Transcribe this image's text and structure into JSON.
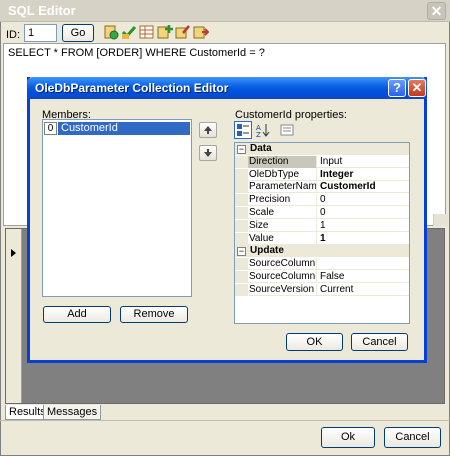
{
  "outer": {
    "title": "SQL Editor",
    "id_label": "ID:",
    "id_value": "1",
    "go_label": "Go",
    "toolbar_icons": [
      "run-query-icon",
      "check-icon",
      "table-icon",
      "add-icon",
      "edit-icon",
      "export-icon"
    ],
    "sql_text": "SELECT * FROM [ORDER] WHERE CustomerId = ?",
    "tabs": [
      {
        "label": "Results",
        "active": true
      },
      {
        "label": "Messages",
        "active": false
      }
    ],
    "ok_label": "Ok",
    "cancel_label": "Cancel"
  },
  "dialog": {
    "title": "OleDbParameter Collection Editor",
    "help_label": "?",
    "close_label": "✕",
    "members_label": "Members:",
    "members": [
      {
        "index": "0",
        "name": "CustomerId"
      }
    ],
    "add_label": "Add",
    "remove_label": "Remove",
    "properties_label": "CustomerId properties:",
    "categories": [
      {
        "name": "Data",
        "toggle": "−",
        "rows": [
          {
            "name": "Direction",
            "value": "Input",
            "bold": false,
            "selected": true
          },
          {
            "name": "OleDbType",
            "value": "Integer",
            "bold": true,
            "selected": false
          },
          {
            "name": "ParameterName",
            "value": "CustomerId",
            "bold": true,
            "selected": false
          },
          {
            "name": "Precision",
            "value": "0",
            "bold": false,
            "selected": false
          },
          {
            "name": "Scale",
            "value": "0",
            "bold": false,
            "selected": false
          },
          {
            "name": "Size",
            "value": "1",
            "bold": false,
            "selected": false
          },
          {
            "name": "Value",
            "value": "1",
            "bold": true,
            "selected": false
          }
        ]
      },
      {
        "name": "Update",
        "toggle": "−",
        "rows": [
          {
            "name": "SourceColumn",
            "value": "",
            "bold": false,
            "selected": false
          },
          {
            "name": "SourceColumnNu",
            "value": "False",
            "bold": false,
            "selected": false
          },
          {
            "name": "SourceVersion",
            "value": "Current",
            "bold": false,
            "selected": false
          }
        ]
      }
    ],
    "ok_label": "OK",
    "cancel_label": "Cancel"
  },
  "colors": {
    "titlebar_blue": "#0053e1",
    "selection": "#316ac5",
    "face": "#ece9d8"
  }
}
